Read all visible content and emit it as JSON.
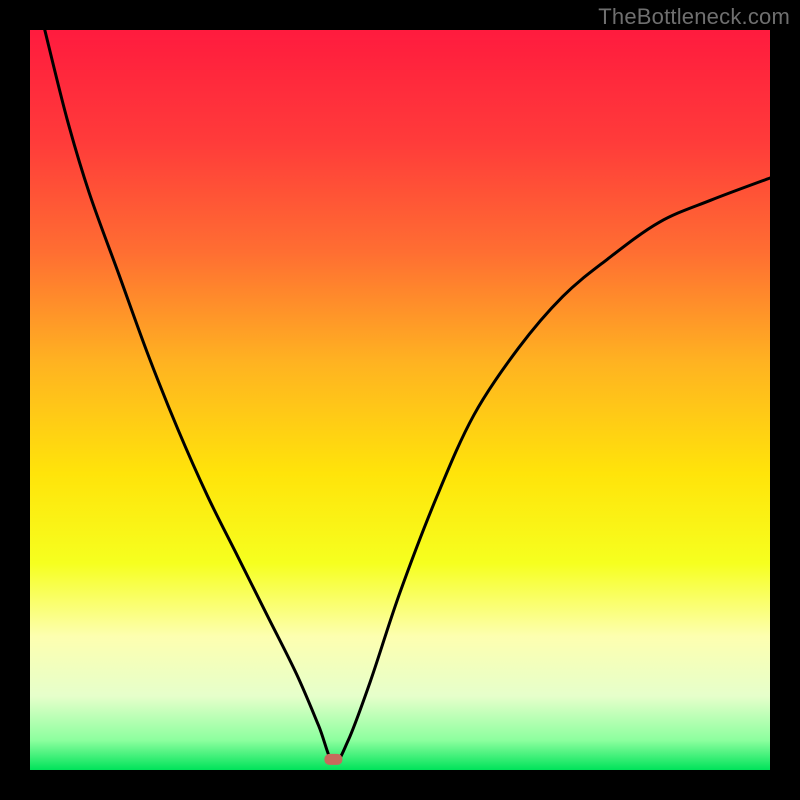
{
  "watermark": "TheBottleneck.com",
  "chart_data": {
    "type": "line",
    "title": "",
    "xlabel": "",
    "ylabel": "",
    "xlim": [
      0,
      100
    ],
    "ylim": [
      0,
      100
    ],
    "background_gradient": {
      "stops": [
        {
          "offset": 0.0,
          "color": "#ff1b3e"
        },
        {
          "offset": 0.15,
          "color": "#ff3b3a"
        },
        {
          "offset": 0.3,
          "color": "#ff6e32"
        },
        {
          "offset": 0.45,
          "color": "#ffb321"
        },
        {
          "offset": 0.6,
          "color": "#ffe40a"
        },
        {
          "offset": 0.72,
          "color": "#f6ff1f"
        },
        {
          "offset": 0.82,
          "color": "#fdffb0"
        },
        {
          "offset": 0.9,
          "color": "#e6ffcb"
        },
        {
          "offset": 0.96,
          "color": "#8cff9e"
        },
        {
          "offset": 1.0,
          "color": "#00e35a"
        }
      ]
    },
    "marker": {
      "x": 41,
      "y": 1.5,
      "color": "#c66b5c"
    },
    "series": [
      {
        "name": "curve",
        "x": [
          2,
          5,
          8,
          12,
          16,
          20,
          24,
          28,
          32,
          36,
          39,
          41,
          43,
          46,
          50,
          55,
          60,
          66,
          72,
          78,
          85,
          92,
          100
        ],
        "values": [
          100,
          88,
          78,
          67,
          56,
          46,
          37,
          29,
          21,
          13,
          6,
          1,
          4,
          12,
          24,
          37,
          48,
          57,
          64,
          69,
          74,
          77,
          80
        ]
      }
    ]
  }
}
